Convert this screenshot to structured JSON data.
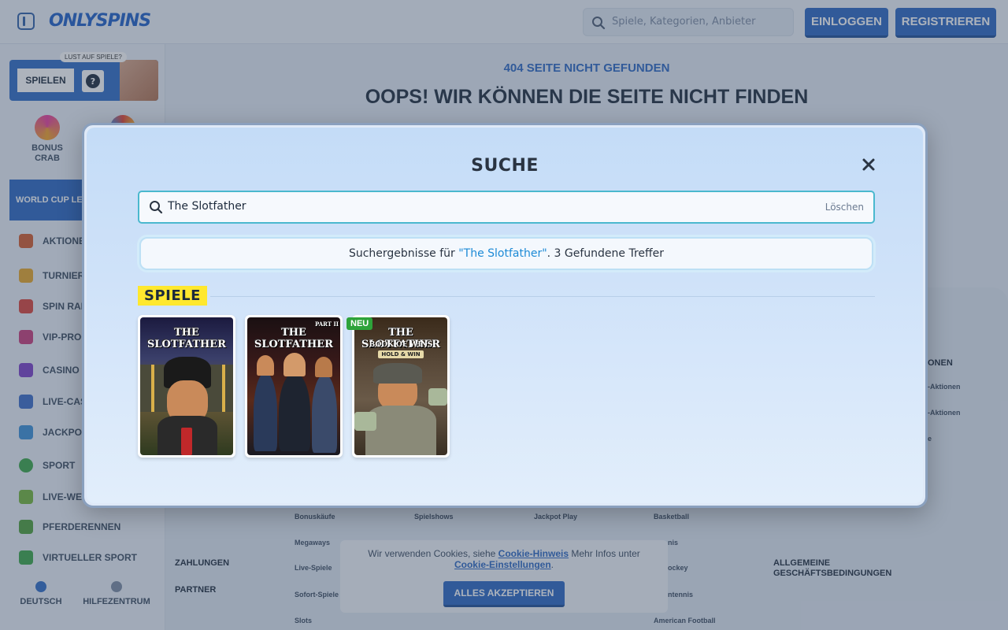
{
  "header": {
    "logo": "ONLYSPINS",
    "search_placeholder": "Spiele, Kategorien, Anbieter",
    "login_label": "EINLOGGEN",
    "register_label": "REGISTRIEREN"
  },
  "sidebar": {
    "promo_tag": "LUST AUF SPIELE?",
    "promo_play": "SPIELEN",
    "promo_help": "?",
    "bonus_crab": "BONUS CRAB",
    "world_cup": "WORLD CUP LEGE",
    "items": [
      {
        "label": "AKTIONEN",
        "color": "#d35a2b"
      },
      {
        "label": "TURNIERE",
        "color": "#e7a526"
      },
      {
        "label": "SPIN RALLY",
        "color": "#d9423a"
      },
      {
        "label": "VIP-PROGR",
        "color": "#c93b7a"
      },
      {
        "label": "CASINO",
        "color": "#7b3fc8"
      },
      {
        "label": "LIVE-CASI",
        "color": "#3a6bc8"
      },
      {
        "label": "JACKPOT-S",
        "color": "#3a8fd8"
      },
      {
        "label": "SPORT",
        "color": "#3aa648"
      },
      {
        "label": "LIVE-WET",
        "color": "#72b63a"
      },
      {
        "label": "PFERDERENNEN",
        "color": "#4d9f3a"
      },
      {
        "label": "VIRTUELLER SPORT",
        "color": "#3aa648"
      }
    ],
    "language": "DEUTSCH",
    "help": "HILFEZENTRUM"
  },
  "page": {
    "subtitle": "404 SEITE NICHT GEFUNDEN",
    "title": "OOPS! WIR KÖNNEN DIE SEITE NICHT FINDEN"
  },
  "footer": {
    "col1": [
      "Bonuskäufe",
      "Megaways",
      "Live-Spiele",
      "Sofort-Spiele",
      "Slots"
    ],
    "col2": [
      "Spielshows"
    ],
    "col3": [
      "Jackpot Play"
    ],
    "col4": [
      "Basketball",
      "nis",
      "ockey",
      "ntennis",
      "American Football"
    ],
    "right_heading": "ONEN",
    "right_items": [
      "-Aktionen",
      "-Aktionen",
      "e"
    ],
    "payments": "ZAHLUNGEN",
    "partner": "PARTNER",
    "terms": "ALLGEMEINE GESCHÄFTSBEDINGUNGEN"
  },
  "cookie": {
    "text1": "Wir verwenden Cookies, siehe",
    "link1": "Cookie-Hinweis",
    "text2": "Mehr Infos unter",
    "link2": "Cookie-Einstellungen",
    "text3": ".",
    "accept": "ALLES AKZEPTIEREN"
  },
  "modal": {
    "title": "SUCHE",
    "search_value": "The Slotfather",
    "clear_label": "Löschen",
    "result_prefix": "Suchergebnisse für",
    "result_query": "\"The Slotfather\"",
    "result_suffix": ". 3 Gefundene Treffer",
    "section": "SPIELE",
    "games": [
      {
        "title": "THE SLOTFATHER",
        "sub": "",
        "sub2": "",
        "badge": ""
      },
      {
        "title": "THE SLOTFATHER",
        "sub": "PART II",
        "sub2": "",
        "badge": ""
      },
      {
        "title": "THE SLOTFATHER",
        "sub": "BOOK OF WINS",
        "sub2": "HOLD & WIN",
        "badge": "NEU"
      }
    ]
  }
}
